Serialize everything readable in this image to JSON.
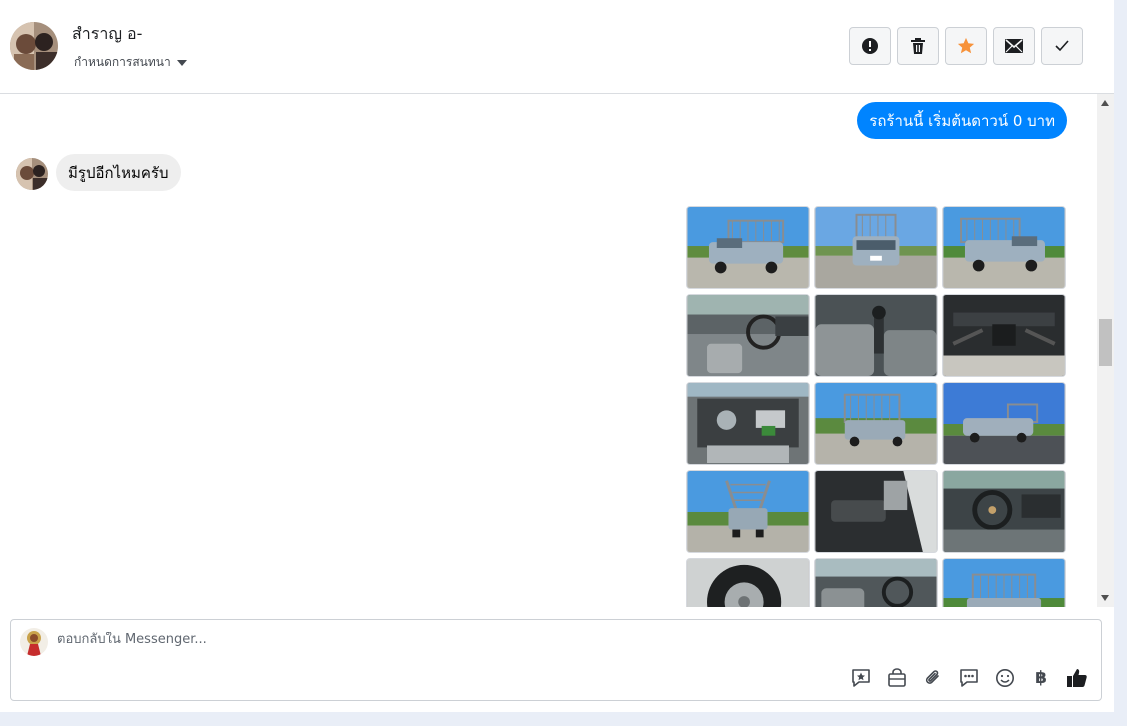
{
  "header": {
    "contact_name": "สำราญ อ-",
    "conversation_menu_label": "กำหนดการสนทนา",
    "actions": [
      {
        "name": "spam-button",
        "icon": "exclamation-circle-icon"
      },
      {
        "name": "delete-button",
        "icon": "trash-icon"
      },
      {
        "name": "star-button",
        "icon": "star-icon"
      },
      {
        "name": "mark-unread-button",
        "icon": "envelope-icon"
      },
      {
        "name": "mark-done-button",
        "icon": "checkmark-icon"
      }
    ]
  },
  "messages": {
    "outgoing_text": "รถร้านนี้ เริ่มต้นดาวน์ 0 บาท",
    "incoming_text": "มีรูปอีกไหมครับ"
  },
  "photo_grid": {
    "photos": [
      {
        "subject": "pickup-front-left"
      },
      {
        "subject": "pickup-front"
      },
      {
        "subject": "pickup-front-right"
      },
      {
        "subject": "interior-dashboard"
      },
      {
        "subject": "interior-gear-shift"
      },
      {
        "subject": "underbody"
      },
      {
        "subject": "engine-bay"
      },
      {
        "subject": "pickup-rear-left"
      },
      {
        "subject": "pickup-side"
      },
      {
        "subject": "pickup-rear"
      },
      {
        "subject": "door-panel"
      },
      {
        "subject": "steering-wheel"
      },
      {
        "subject": "wheel-tire"
      },
      {
        "subject": "interior-cabin"
      },
      {
        "subject": "pickup-cage-view"
      }
    ]
  },
  "composer": {
    "placeholder": "ตอบกลับใน Messenger...",
    "tools": [
      "saved-reply-icon",
      "shopping-bag-icon",
      "paperclip-icon",
      "chat-bubbles-icon",
      "smiley-icon",
      "baht-icon",
      "thumbs-up-icon"
    ],
    "baht_symbol": "฿"
  },
  "colors": {
    "messenger_blue": "#0084ff",
    "incoming_bubble": "#eeeeee",
    "star_orange": "#f7923a",
    "icon_gray": "#444950"
  }
}
